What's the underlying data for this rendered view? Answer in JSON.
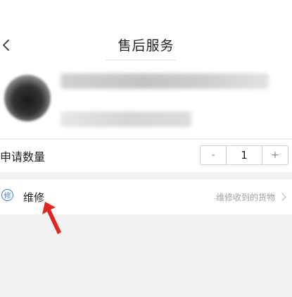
{
  "header": {
    "title": "售后服务",
    "back_icon": "chevron-left-icon"
  },
  "product": {
    "name": "",
    "spec": ""
  },
  "quantity": {
    "label": "申请数量",
    "decrement": "-",
    "value": "1",
    "increment": "+"
  },
  "service_option": {
    "icon_text": "修",
    "label": "维修",
    "description": "维修收到的货物",
    "chevron_icon": "chevron-right-icon"
  },
  "colors": {
    "accent_blue": "#3e7fd1",
    "annotation_red": "#e0271f",
    "background": "#f2f2f2"
  }
}
